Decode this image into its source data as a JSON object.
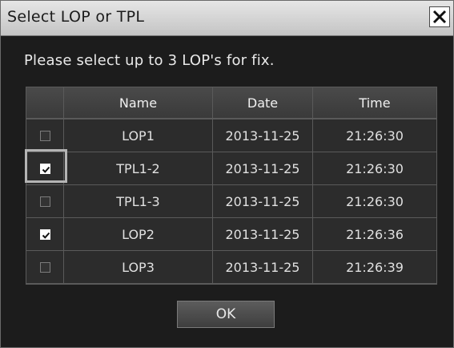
{
  "dialog": {
    "title": "Select LOP or TPL",
    "instruction": "Please select up to 3 LOP's for fix.",
    "ok_label": "OK"
  },
  "table": {
    "columns": [
      "",
      "Name",
      "Date",
      "Time"
    ],
    "rows": [
      {
        "checked": false,
        "name": "LOP1",
        "date": "2013-11-25",
        "time": "21:26:30"
      },
      {
        "checked": true,
        "name": "TPL1-2",
        "date": "2013-11-25",
        "time": "21:26:30"
      },
      {
        "checked": false,
        "name": "TPL1-3",
        "date": "2013-11-25",
        "time": "21:26:30"
      },
      {
        "checked": true,
        "name": "LOP2",
        "date": "2013-11-25",
        "time": "21:26:36"
      },
      {
        "checked": false,
        "name": "LOP3",
        "date": "2013-11-25",
        "time": "21:26:39"
      }
    ]
  },
  "colors": {
    "titlebar": "#d6d6d6",
    "background": "#1c1c1c",
    "row": "#2c2c2c",
    "grid_line": "#5a5a5a"
  }
}
